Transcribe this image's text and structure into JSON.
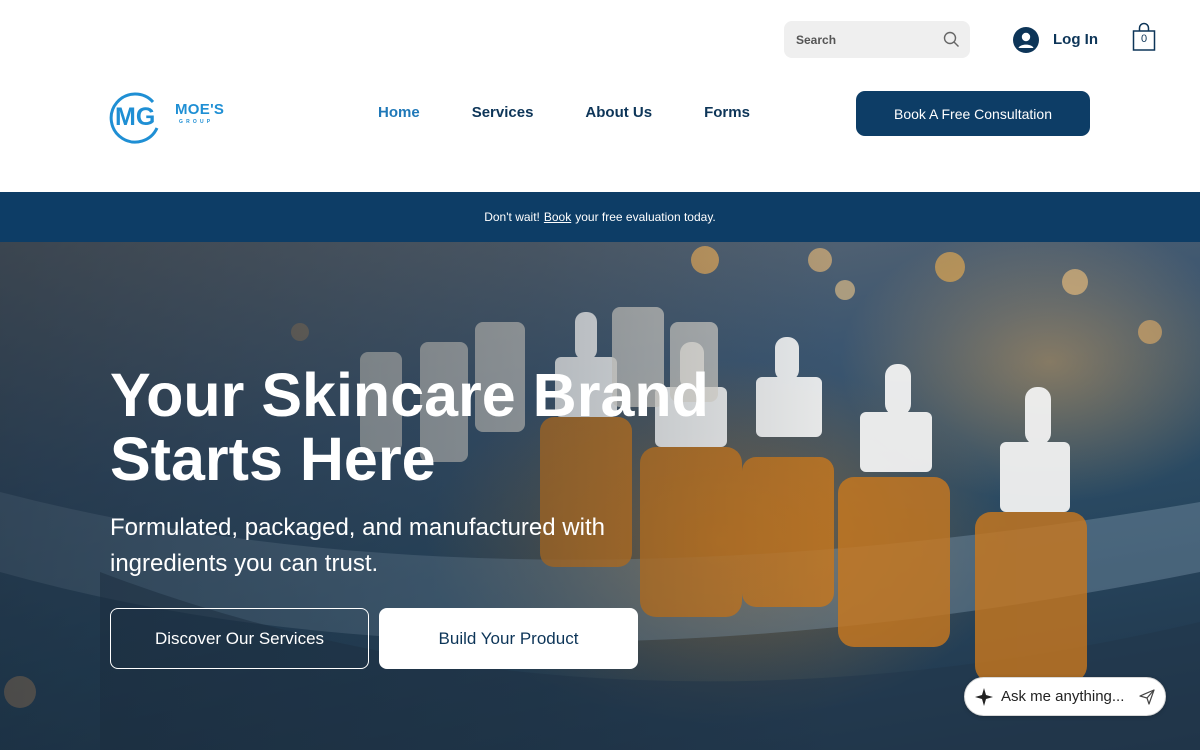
{
  "header": {
    "search": {
      "placeholder": "Search",
      "icon": "search-icon"
    },
    "login": {
      "label": "Log In",
      "icon": "user-avatar-icon"
    },
    "cart": {
      "count": "0",
      "icon": "shopping-bag-icon"
    },
    "logo": {
      "monogram": "MG",
      "wordmark": "MOE'S",
      "subtext": "GROUP"
    },
    "nav": [
      {
        "label": "Home",
        "active": true
      },
      {
        "label": "Services",
        "active": false
      },
      {
        "label": "About Us",
        "active": false
      },
      {
        "label": "Forms",
        "active": false
      }
    ],
    "cta_label": "Book A Free Consultation"
  },
  "banner": {
    "prefix": "Don't wait!",
    "link": "Book",
    "suffix": "your free evaluation today."
  },
  "hero": {
    "title_line1": "Your Skincare Brand",
    "title_line2": "Starts Here",
    "subtitle": "Formulated, packaged, and manufactured with ingredients you can trust.",
    "primary_button": "Discover Our Services",
    "secondary_button": "Build Your Product"
  },
  "chat": {
    "placeholder": "Ask me anything...",
    "icon": "sparkle-icon",
    "send_icon": "send-icon"
  },
  "colors": {
    "navy": "#0d3d66",
    "nav_text": "#0d3558",
    "active_nav": "#1f78b8",
    "brand_blue": "#1f8fd4"
  }
}
